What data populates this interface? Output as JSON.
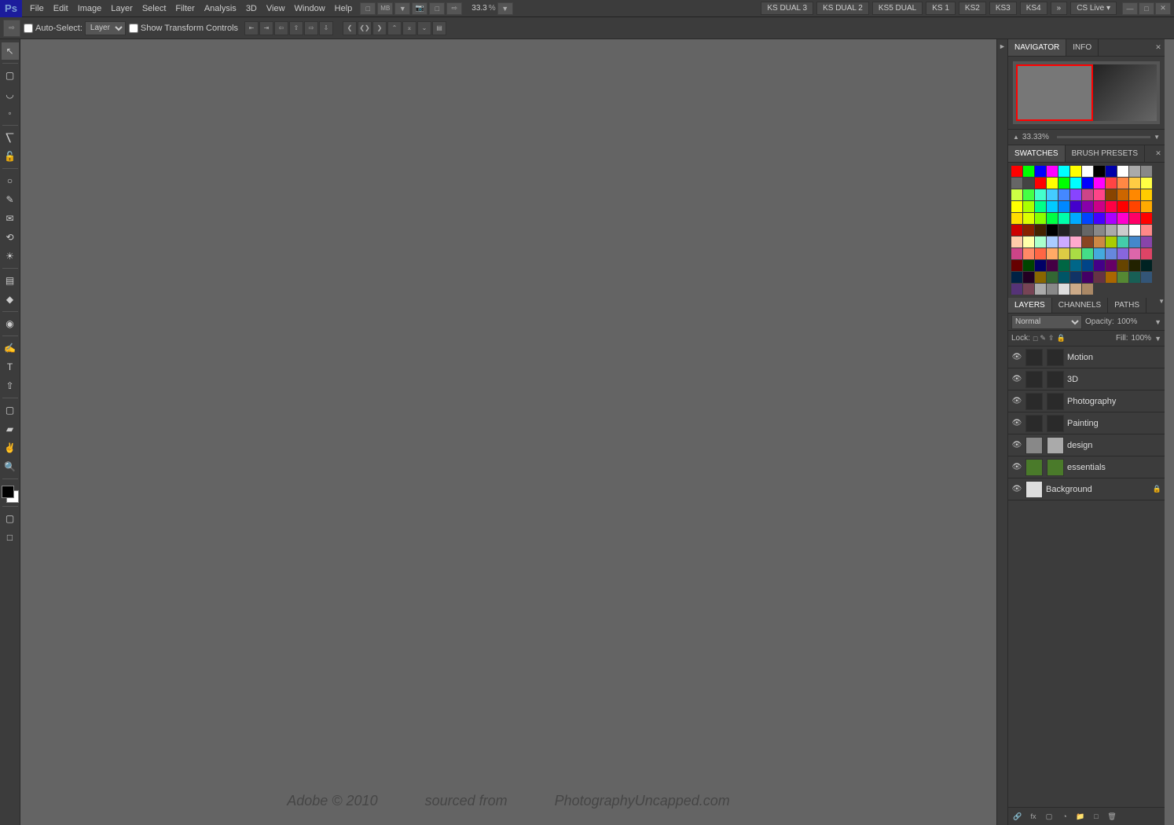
{
  "menubar": {
    "ps_logo": "Ps",
    "menus": [
      "File",
      "Edit",
      "Image",
      "Layer",
      "Select",
      "Filter",
      "Analysis",
      "3D",
      "View",
      "Window",
      "Help"
    ],
    "workspace_buttons": [
      "KS DUAL 3",
      "KS DUAL 2",
      "KS5 DUAL",
      "KS 1",
      "KS2",
      "KS3",
      "KS4"
    ],
    "cs_live": "CS Live ▾"
  },
  "optionsbar": {
    "auto_select_label": "Auto-Select:",
    "auto_select_value": "Layer",
    "show_transform_label": "Show Transform Controls",
    "zoom_value": "33.3"
  },
  "toolbar": {
    "tools": [
      "↖",
      "⬜",
      "⬭",
      "✂",
      "✒",
      "🖌",
      "🪣",
      "🔍",
      "🔠",
      "📐",
      "🎨",
      "🖊",
      "⛏",
      "🔲",
      "👁"
    ]
  },
  "navigator": {
    "tab_navigator": "NAVIGATOR",
    "tab_info": "INFO",
    "zoom_value": "33.33%"
  },
  "swatches": {
    "tab_swatches": "SWATCHES",
    "tab_brush_presets": "BRUSH PRESETS",
    "colors": [
      "#ff0000",
      "#00ff00",
      "#0000ff",
      "#ff00ff",
      "#00ffff",
      "#ffff00",
      "#ffffff",
      "#000000",
      "#0000aa",
      "#ffffff",
      "#aaaaaa",
      "#888888",
      "#666666",
      "#444444",
      "#ff0000",
      "#ffff00",
      "#00ff00",
      "#00ffff",
      "#0000ff",
      "#ff00ff",
      "#ff4444",
      "#ff8844",
      "#ffcc44",
      "#ffff44",
      "#ccff44",
      "#44ff44",
      "#44ffcc",
      "#44ccff",
      "#4488ff",
      "#8844ff",
      "#cc4488",
      "#ff4488",
      "#884400",
      "#cc6600",
      "#ff8800",
      "#ffcc00",
      "#ffff00",
      "#aaff00",
      "#00ff88",
      "#00ccff",
      "#0088ff",
      "#4400cc",
      "#8800aa",
      "#cc0088",
      "#ff0044",
      "#ff0000",
      "#ff4400",
      "#ffaa00",
      "#ffdd00",
      "#ddff00",
      "#88ff00",
      "#00ff44",
      "#00ffaa",
      "#00aaff",
      "#0044ff",
      "#4400ff",
      "#aa00ff",
      "#ff00cc",
      "#ff0066",
      "#ff0000",
      "#cc0000",
      "#882200",
      "#442200",
      "#000000",
      "#222222",
      "#444444",
      "#666666",
      "#888888",
      "#aaaaaa",
      "#cccccc",
      "#ffffff",
      "#ff8888",
      "#ffccaa",
      "#ffffaa",
      "#aaffcc",
      "#aaccff",
      "#ccaaff",
      "#ffaacc",
      "#884422",
      "#cc8844",
      "#aacc00",
      "#44ccaa",
      "#4488cc",
      "#8844aa",
      "#cc4488",
      "#ff8866",
      "#ff6644",
      "#ffaa66",
      "#ddcc44",
      "#aadd44",
      "#44dd88",
      "#44aadd",
      "#6688dd",
      "#8866dd",
      "#dd66aa",
      "#dd4466",
      "#660000",
      "#004400",
      "#000066",
      "#440044",
      "#006644",
      "#006688",
      "#004488",
      "#440088",
      "#660066",
      "#664400",
      "#222200",
      "#002222",
      "#002244",
      "#220022",
      "#886600",
      "#336633",
      "#005566",
      "#113366",
      "#440066",
      "#663344",
      "#aa6600",
      "#558833",
      "#00776699",
      "#335577",
      "#553377",
      "#774455",
      "#aaaaaa",
      "#888888",
      "#dddddd",
      "#ccaa88",
      "#aa8866"
    ]
  },
  "layers": {
    "tab_layers": "LAYERS",
    "tab_channels": "CHANNELS",
    "tab_paths": "PATHS",
    "blend_mode": "Normal",
    "opacity_label": "Opacity:",
    "opacity_value": "100%",
    "fill_label": "Fill:",
    "fill_value": "100%",
    "layer_list": [
      {
        "name": "Motion",
        "visible": true,
        "thumb": "dark",
        "active": false
      },
      {
        "name": "3D",
        "visible": true,
        "thumb": "dark",
        "active": false
      },
      {
        "name": "Photography",
        "visible": true,
        "thumb": "dark",
        "active": false
      },
      {
        "name": "Painting",
        "visible": true,
        "thumb": "dark",
        "active": false
      },
      {
        "name": "design",
        "visible": true,
        "thumb": "light",
        "active": false
      },
      {
        "name": "essentials",
        "visible": true,
        "thumb": "green",
        "active": false
      },
      {
        "name": "Background",
        "visible": true,
        "thumb": "white",
        "active": false,
        "locked": true
      }
    ]
  },
  "watermark": {
    "left": "Adobe © 2010",
    "middle": "sourced from",
    "right": "PhotographyUncapped.com"
  }
}
